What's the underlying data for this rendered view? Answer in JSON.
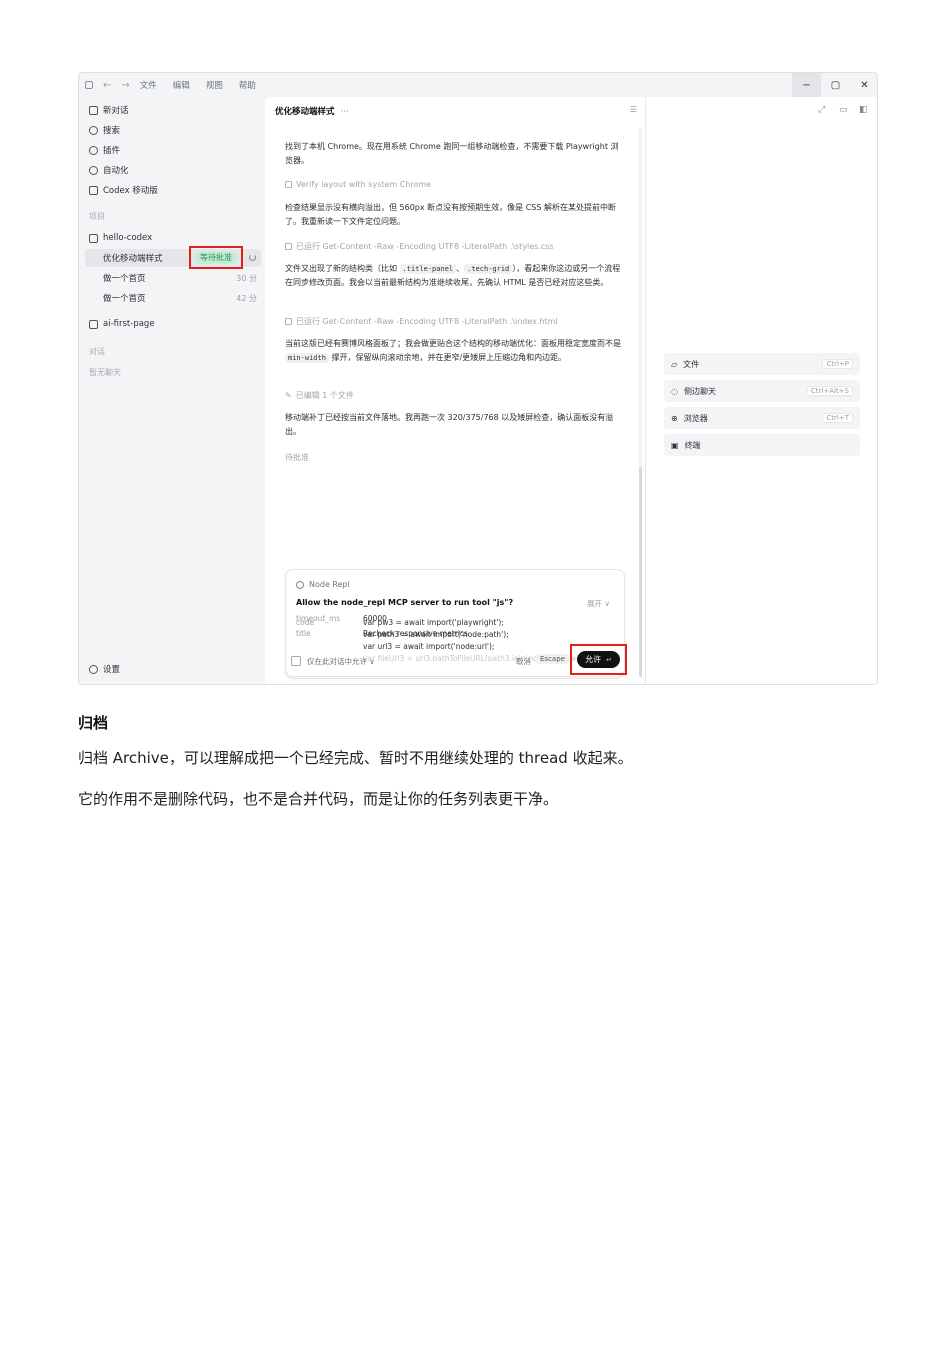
{
  "window": {
    "menus": [
      "文件",
      "编辑",
      "视图",
      "帮助"
    ],
    "controls": [
      "−",
      "▢",
      "✕"
    ]
  },
  "sidebar": {
    "nav": [
      "新对话",
      "搜索",
      "插件",
      "自动化",
      "Codex 移动版"
    ],
    "projects_label": "项目",
    "project_1": "hello-codex",
    "threads": [
      {
        "title": "优化移动端样式",
        "age": ""
      },
      {
        "title": "做一个首页",
        "age": "30 分"
      },
      {
        "title": "做一个首页",
        "age": "42 分"
      }
    ],
    "pending_badge": "等待批准",
    "project_2": "ai-first-page",
    "chats_label": "对话",
    "no_chats": "暂无聊天",
    "settings": "设置"
  },
  "chat": {
    "title": "优化移动端样式",
    "more": "···",
    "msg1": "找到了本机 Chrome。现在用系统 Chrome 跑同一组移动端检查，不需要下载 Playwright 浏览器。",
    "tool1": "Verify layout with system Chrome",
    "msg2": "检查结果显示没有横向溢出，但 560px 断点没有按预期生效，像是 CSS 解析在某处提前中断了。我重新读一下文件定位问题。",
    "tool2": "已运行 Get-Content -Raw -Encoding UTF8 -LiteralPath .\\styles.css",
    "msg3_a": "文件又出现了新的结构类（比如 ",
    "msg3_code1": ".title-panel",
    "msg3_sep": "、",
    "msg3_code2": ".tech-grid",
    "msg3_b": "），看起来你这边或另一个流程在同步修改页面。我会以当前最新结构为准继续收尾，先确认 HTML 是否已经对应这些类。",
    "tool3": "已运行 Get-Content -Raw -Encoding UTF8 -LiteralPath .\\index.html",
    "msg4_a": "当前这版已经有赛博风格面板了；我会做更贴合这个结构的移动端优化：面板用稳定宽度而不是 ",
    "msg4_code": "min-width",
    "msg4_b": " 撑开，保留纵向滚动余地，并在更窄/更矮屏上压缩边角和内边距。",
    "tool4": "已编辑 1 个文件",
    "msg5": "移动端补丁已经按当前文件落地。我再跑一次 320/375/768 以及矮屏检查，确认面板没有溢出。",
    "status": "待批准"
  },
  "approval": {
    "app": "Node Repl",
    "question": "Allow the node_repl MCP server to run tool \"js\"?",
    "code_label": "code",
    "code_lines": [
      "var pw3 = await import('playwright');",
      "var path3 = await import('node:path');",
      "var url3 = await import('node:url');",
      "var fileUrl3 = url3.pathToFileURL(path3.join(nodeRepl.cwd, ..."
    ],
    "expand": "展开 ∨",
    "timeout_label": "timeout_ms",
    "timeout_value": "60000",
    "title_label": "title",
    "title_value": "Recheck responsive metrics",
    "only_this": "仅在此对话中允许 ∨",
    "cancel": "取消",
    "escape": "Escape",
    "allow": "允许"
  },
  "right_panel": {
    "items": [
      {
        "label": "文件",
        "shortcut": "Ctrl+P"
      },
      {
        "label": "侧边聊天",
        "shortcut": "Ctrl+Alt+S"
      },
      {
        "label": "浏览器",
        "shortcut": "Ctrl+T"
      },
      {
        "label": "终端",
        "shortcut": ""
      }
    ]
  },
  "document": {
    "heading": "归档",
    "para1": "归档 Archive，可以理解成把一个已经完成、暂时不用继续处理的 thread 收起来。",
    "para2": "它的作用不是删除代码，也不是合并代码，而是让你的任务列表更干净。"
  },
  "colors": {
    "highlight_red": "#e0211b",
    "badge_green_bg": "#c7ecd6",
    "badge_green_text": "#229556",
    "allow_button": "#111111"
  }
}
